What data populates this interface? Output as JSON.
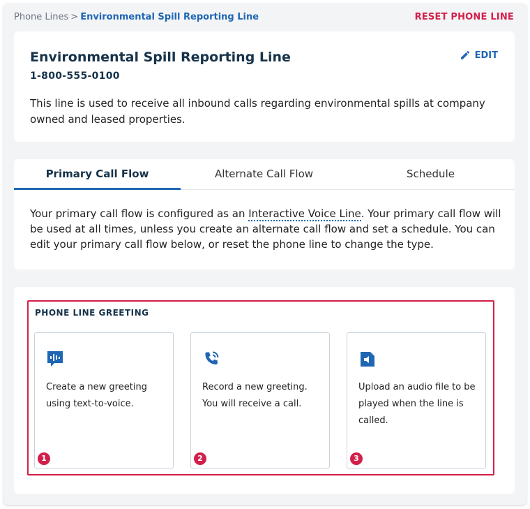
{
  "breadcrumb": {
    "root": "Phone Lines",
    "separator": ">",
    "current": "Environmental Spill Reporting Line"
  },
  "reset_label": "RESET PHONE LINE",
  "line": {
    "title": "Environmental Spill Reporting Line",
    "number": "1-800-555-0100",
    "edit_label": "EDIT",
    "description": "This line is used to receive all inbound calls regarding environmental spills at company owned and leased properties."
  },
  "tabs": [
    {
      "label": "Primary Call Flow",
      "active": true
    },
    {
      "label": "Alternate Call Flow",
      "active": false
    },
    {
      "label": "Schedule",
      "active": false
    }
  ],
  "primary": {
    "text_before": "Your primary call flow is configured as an ",
    "link": "Interactive Voice Line",
    "text_after": ". Your primary call flow will be used at all times, unless you create an alternate call flow and set a schedule. You can edit your primary call flow below, or reset the phone line to change the type."
  },
  "greeting": {
    "heading": "PHONE LINE GREETING",
    "options": [
      {
        "text": "Create a new greeting using text-to-voice.",
        "badge": "1",
        "icon": "text-to-voice-icon"
      },
      {
        "text": "Record a new greeting. You will receive a call.",
        "badge": "2",
        "icon": "phone-ringing-icon"
      },
      {
        "text": "Upload an audio file to be played when the line is called.",
        "badge": "3",
        "icon": "audio-file-icon"
      }
    ]
  },
  "colors": {
    "accent": "#1f66b3",
    "danger": "#d31f4a",
    "heading": "#17334a"
  }
}
